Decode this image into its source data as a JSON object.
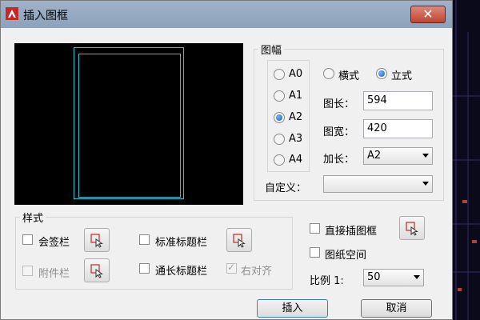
{
  "window": {
    "title": "插入图框",
    "close_label": "✕"
  },
  "sheet_group": {
    "label": "图幅"
  },
  "sizes": [
    {
      "label": "A0",
      "selected": false
    },
    {
      "label": "A1",
      "selected": false
    },
    {
      "label": "A2",
      "selected": true
    },
    {
      "label": "A3",
      "selected": false
    },
    {
      "label": "A4",
      "selected": false
    }
  ],
  "orientation": {
    "landscape": {
      "label": "横式",
      "selected": false
    },
    "portrait": {
      "label": "立式",
      "selected": true
    }
  },
  "length": {
    "label": "图长：",
    "value": "594"
  },
  "width": {
    "label": "图宽：",
    "value": "420"
  },
  "extend": {
    "label": "加长：",
    "value": "A2"
  },
  "custom": {
    "label": "自定义：",
    "value": ""
  },
  "style_group": {
    "label": "样式",
    "sign_bar": {
      "label": "会签栏",
      "checked": false
    },
    "attach_bar": {
      "label": "附件栏",
      "checked": false,
      "enabled": false
    },
    "standard_title": {
      "label": "标准标题栏",
      "checked": false
    },
    "long_title": {
      "label": "通长标题栏",
      "checked": false
    },
    "right_align": {
      "label": "右对齐",
      "checked": true,
      "enabled": false
    }
  },
  "direct_insert": {
    "label": "直接插图框",
    "checked": false
  },
  "paper_space": {
    "label": "图纸空间",
    "checked": false
  },
  "scale": {
    "label": "比例 1:",
    "value": "50"
  },
  "buttons": {
    "insert": "插入",
    "cancel": "取消"
  }
}
